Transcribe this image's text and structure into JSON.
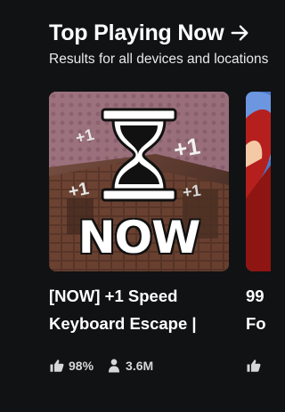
{
  "section": {
    "title": "Top Playing Now",
    "arrow_icon": "arrow-right-icon",
    "subtitle": "Results for all devices and locations"
  },
  "tiles": [
    {
      "title_line1": "[NOW] +1 Speed",
      "title_line2": "Keyboard Escape |",
      "thumb_text": "NOW",
      "badge_texts": [
        "+1",
        "+1",
        "+1",
        "+1"
      ],
      "like_ratio": "98%",
      "players": "3.6M",
      "like_icon": "thumbs-up-icon",
      "players_icon": "person-icon"
    },
    {
      "title_line1": "99",
      "title_line2": "Fo",
      "like_icon": "thumbs-up-icon"
    }
  ],
  "colors": {
    "background": "#111214",
    "text": "#ffffff",
    "stats_text": "#d7d7d9"
  }
}
